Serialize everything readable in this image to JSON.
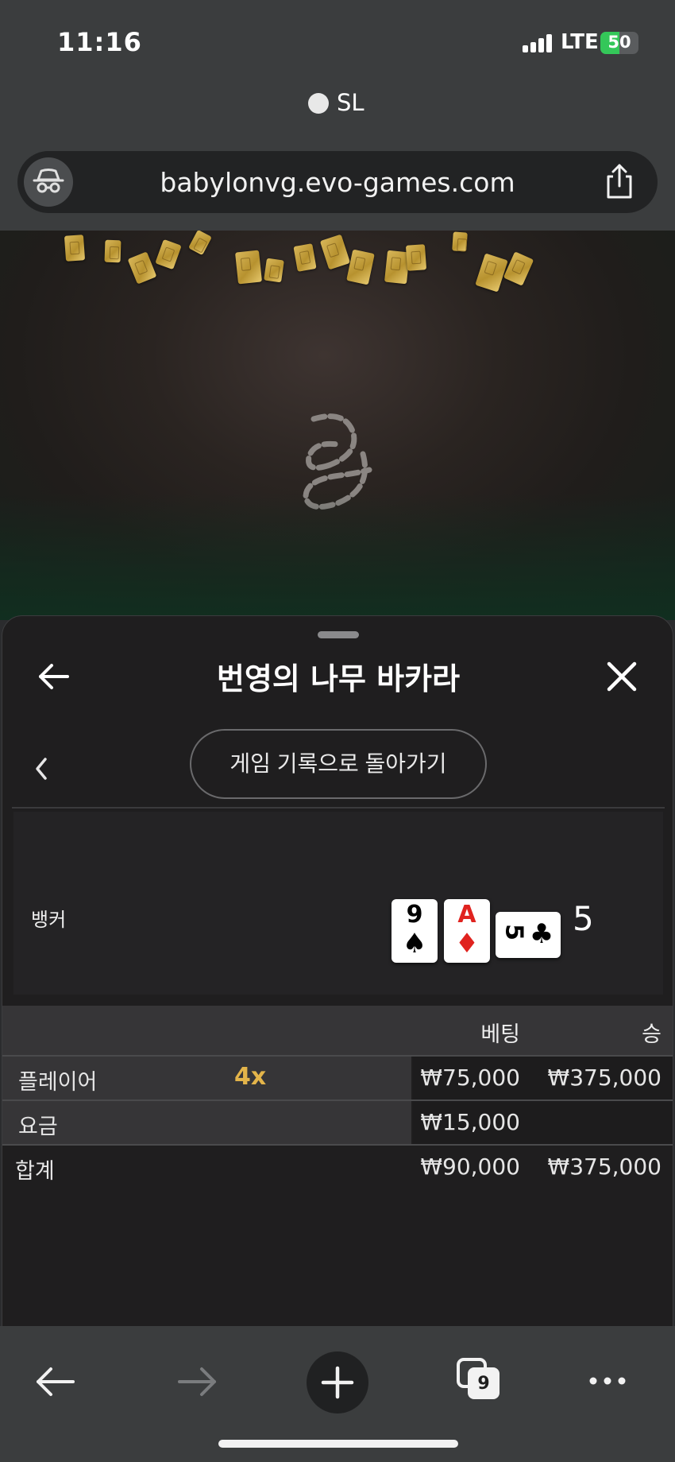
{
  "status_bar": {
    "time": "11:16",
    "network": "LTE",
    "battery": "50",
    "battery_level_percent": 50
  },
  "browser": {
    "recording_label": "SL",
    "url": "babylonvg.evo-games.com",
    "icons": {
      "mode": "incognito-icon",
      "share": "share-icon"
    }
  },
  "sheet": {
    "title": "번영의 나무 바카라",
    "back_icon": "back-arrow-icon",
    "close_icon": "close-icon",
    "prev_icon": "chevron-left-icon",
    "history_button": "게임 기록으로 돌아가기"
  },
  "banker": {
    "label": "뱅커",
    "cards": [
      {
        "rank": "9",
        "suit": "♠",
        "color": "black"
      },
      {
        "rank": "A",
        "suit": "♦",
        "color": "red"
      },
      {
        "rank": "5",
        "suit": "♣",
        "color": "black",
        "orientation": "sideways"
      }
    ],
    "score": "5"
  },
  "bets": {
    "headers": {
      "bet": "베팅",
      "win": "승"
    },
    "rows": [
      {
        "label": "플레이어",
        "multiplier": "4x",
        "bet": "₩75,000",
        "win": "₩375,000"
      },
      {
        "label": "요금",
        "bet": "₩15,000",
        "win": ""
      }
    ],
    "total": {
      "label": "합계",
      "bet": "₩90,000",
      "win": "₩375,000"
    }
  },
  "toolbar": {
    "tab_count": "9",
    "icons": [
      "back-icon",
      "forward-icon",
      "new-tab-icon",
      "tabs-icon",
      "more-icon"
    ]
  },
  "colors": {
    "accent_gold": "#e3b44a",
    "battery_green": "#34c759",
    "card_red": "#e0231f"
  }
}
